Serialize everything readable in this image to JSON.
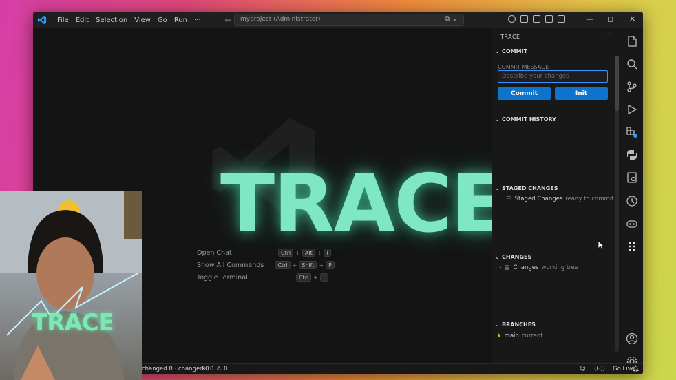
{
  "titlebar": {
    "menu": [
      "File",
      "Edit",
      "Selection",
      "View",
      "Go",
      "Run",
      "···"
    ],
    "command_center": "myproject (Administrator)"
  },
  "editor": {
    "brand_text": "TRACE",
    "shortcuts": [
      {
        "label": "Open Chat",
        "keys": [
          "Ctrl",
          "Alt",
          "I"
        ]
      },
      {
        "label": "Show All Commands",
        "keys": [
          "Ctrl",
          "Shift",
          "P"
        ]
      },
      {
        "label": "Toggle Terminal",
        "keys": [
          "Ctrl",
          "`"
        ]
      }
    ]
  },
  "panel": {
    "title": "TRACE",
    "more": "···",
    "commit_section": "COMMIT",
    "commit_message_label": "COMMIT MESSAGE",
    "commit_message_placeholder": "Describe your changes",
    "commit_button": "Commit",
    "init_button": "Init",
    "history_section": "COMMIT HISTORY",
    "staged_section": "STAGED CHANGES",
    "staged_item": {
      "label": "Staged Changes",
      "detail": "ready to commit"
    },
    "changes_section": "CHANGES",
    "changes_item": {
      "label": "Changes",
      "detail": "working tree"
    },
    "branches_section": "BRANCHES",
    "branch_item": {
      "label": "main",
      "detail": "current"
    }
  },
  "statusbar": {
    "changes": "changed 0 · changed 0",
    "errors": "0",
    "warnings": "0",
    "go_live": "Go Live"
  },
  "webcam": {
    "brand_text": "TRACE"
  },
  "colors": {
    "accent": "#0e73cc",
    "brand": "#7fe7c4",
    "focus": "#3794ff"
  }
}
